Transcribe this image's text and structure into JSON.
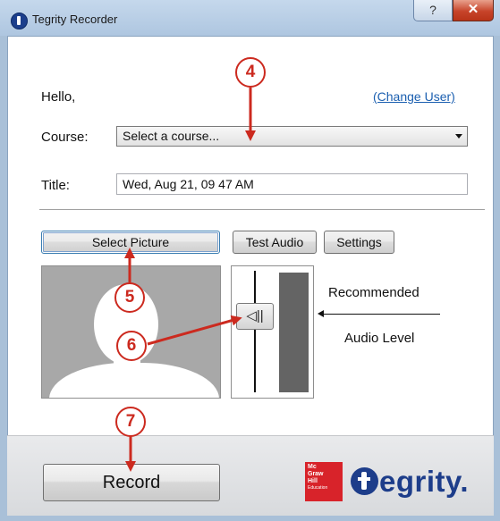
{
  "window": {
    "title": "Tegrity Recorder",
    "help_glyph": "?",
    "close_glyph": "✕"
  },
  "header": {
    "greeting": "Hello,",
    "change_user_link": "(Change User)"
  },
  "course": {
    "label": "Course:",
    "selected": "Select a course..."
  },
  "title_field": {
    "label": "Title:",
    "value": "Wed, Aug 21, 09 47 AM"
  },
  "buttons": {
    "select_picture": "Select Picture",
    "test_audio": "Test Audio",
    "settings": "Settings",
    "record": "Record"
  },
  "audio": {
    "volume_icon": "speaker-icon",
    "volume_glyph": "◁||",
    "note_line1": "Recommended",
    "note_line2": "Audio Level"
  },
  "callouts": [
    "4",
    "5",
    "6",
    "7"
  ],
  "branding": {
    "mh_line1": "Mc",
    "mh_line2": "Graw",
    "mh_line3": "Hill",
    "mh_line4": "Education",
    "tegrity_text": "egrity."
  },
  "colors": {
    "callout_red": "#cc2a1f",
    "link_blue": "#1b5fb0",
    "brand_blue": "#1d3d8a",
    "brand_red": "#d8232a"
  }
}
